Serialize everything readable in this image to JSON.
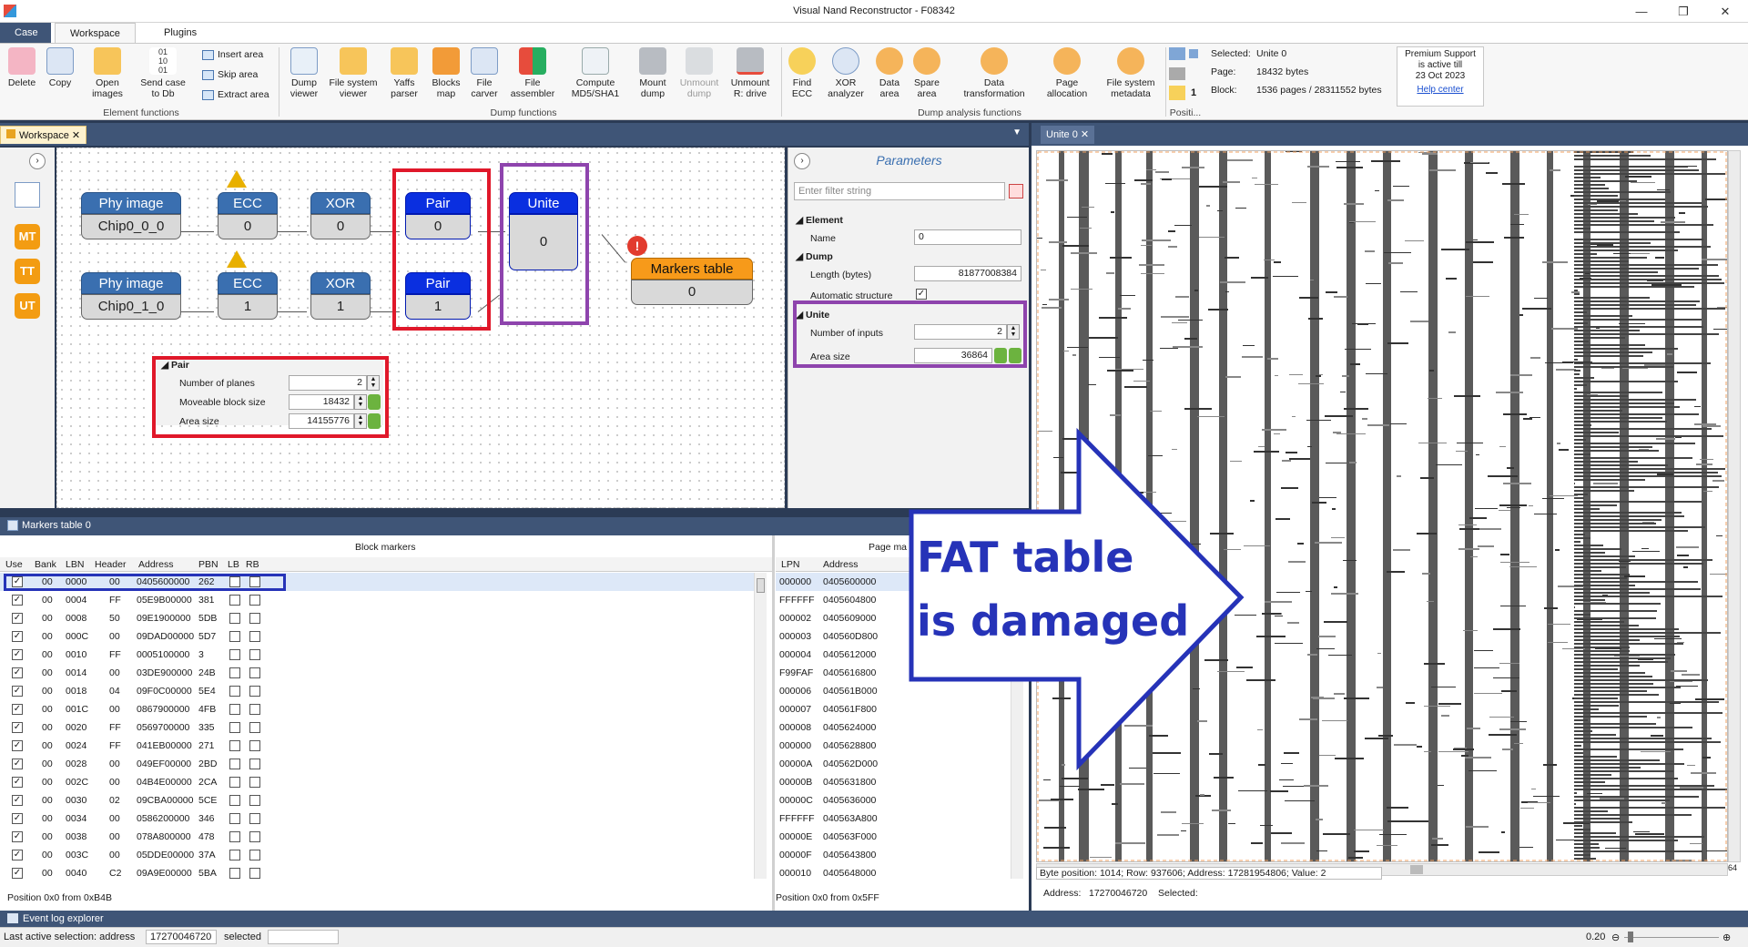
{
  "window": {
    "title": "Visual Nand Reconstructor - F08342"
  },
  "ribbon_tabs": [
    "Case",
    "Workspace",
    "Plugins"
  ],
  "ribbon": {
    "element_functions": {
      "label": "Element functions",
      "buttons": [
        "Delete",
        "Copy",
        "Open images",
        "Send case to Db"
      ],
      "small": [
        "Insert area",
        "Skip area",
        "Extract area"
      ]
    },
    "dump_functions": {
      "label": "Dump functions",
      "buttons": [
        "Dump viewer",
        "File system viewer",
        "Yaffs parser",
        "Blocks map",
        "File carver",
        "File assembler",
        "Compute MD5/SHA1",
        "Mount dump",
        "Unmount dump",
        "Unmount R: drive"
      ]
    },
    "dump_analysis": {
      "label": "Dump analysis functions",
      "buttons": [
        "Find ECC",
        "XOR analyzer",
        "Data area",
        "Spare area",
        "Data transformation",
        "Page allocation",
        "File system metadata"
      ]
    },
    "position": {
      "label": "Positi...",
      "value": "1",
      "selected_label": "Selected:",
      "selected_value": "Unite 0",
      "page_label": "Page:",
      "page_value": "18432 bytes",
      "block_label": "Block:",
      "block_value": "1536 pages / 28311552 bytes"
    },
    "support": {
      "line1": "Premium Support",
      "line2": "is active till",
      "line3": "23 Oct 2023",
      "link": "Help center"
    }
  },
  "workspace_tab": "Workspace",
  "viewer_tab": "Unite 0",
  "nodes": {
    "phy1": {
      "title": "Phy image",
      "value": "Chip0_0_0"
    },
    "phy2": {
      "title": "Phy image",
      "value": "Chip0_1_0"
    },
    "ecc1": {
      "title": "ECC",
      "value": "0"
    },
    "ecc2": {
      "title": "ECC",
      "value": "1"
    },
    "xor1": {
      "title": "XOR",
      "value": "0"
    },
    "xor2": {
      "title": "XOR",
      "value": "1"
    },
    "pair1": {
      "title": "Pair",
      "value": "0"
    },
    "pair2": {
      "title": "Pair",
      "value": "1"
    },
    "unite": {
      "title": "Unite",
      "value": "0"
    },
    "markers": {
      "title": "Markers table",
      "value": "0"
    }
  },
  "pair_props": {
    "section": "Pair",
    "rows": [
      {
        "label": "Number of planes",
        "value": "2"
      },
      {
        "label": "Moveable block size",
        "value": "18432"
      },
      {
        "label": "Area size",
        "value": "14155776"
      }
    ]
  },
  "params": {
    "title": "Parameters",
    "filter_placeholder": "Enter filter string",
    "element_section": "Element",
    "name_label": "Name",
    "name_value": "0",
    "dump_section": "Dump",
    "length_label": "Length (bytes)",
    "length_value": "81877008384",
    "auto_label": "Automatic structure",
    "unite_section": "Unite",
    "inputs_label": "Number of inputs",
    "inputs_value": "2",
    "area_label": "Area size",
    "area_value": "36864"
  },
  "markers_panel": {
    "tab": "Markers table 0",
    "block_markers_title": "Block markers",
    "page_markers_title": "Page ma",
    "columns": [
      "Use",
      "Bank",
      "LBN",
      "Header",
      "Address",
      "PBN",
      "LB",
      "RB"
    ],
    "rows": [
      [
        "00",
        "0000",
        "00",
        "0405600000",
        "262"
      ],
      [
        "00",
        "0004",
        "FF",
        "05E9B00000",
        "381"
      ],
      [
        "00",
        "0008",
        "50",
        "09E1900000",
        "5DB"
      ],
      [
        "00",
        "000C",
        "00",
        "09DAD00000",
        "5D7"
      ],
      [
        "00",
        "0010",
        "FF",
        "0005100000",
        "3"
      ],
      [
        "00",
        "0014",
        "00",
        "03DE900000",
        "24B"
      ],
      [
        "00",
        "0018",
        "04",
        "09F0C00000",
        "5E4"
      ],
      [
        "00",
        "001C",
        "00",
        "0867900000",
        "4FB"
      ],
      [
        "00",
        "0020",
        "FF",
        "0569700000",
        "335"
      ],
      [
        "00",
        "0024",
        "FF",
        "041EB00000",
        "271"
      ],
      [
        "00",
        "0028",
        "00",
        "049EF00000",
        "2BD"
      ],
      [
        "00",
        "002C",
        "00",
        "04B4E00000",
        "2CA"
      ],
      [
        "00",
        "0030",
        "02",
        "09CBA00000",
        "5CE"
      ],
      [
        "00",
        "0034",
        "00",
        "0586200000",
        "346"
      ],
      [
        "00",
        "0038",
        "00",
        "078A800000",
        "478"
      ],
      [
        "00",
        "003C",
        "00",
        "05DDE00000",
        "37A"
      ],
      [
        "00",
        "0040",
        "C2",
        "09A9E00000",
        "5BA"
      ]
    ],
    "page_columns": [
      "LPN",
      "Address"
    ],
    "page_rows": [
      [
        "000000",
        "0405600000"
      ],
      [
        "FFFFFF",
        "0405604800"
      ],
      [
        "000002",
        "0405609000"
      ],
      [
        "000003",
        "040560D800"
      ],
      [
        "000004",
        "0405612000"
      ],
      [
        "F99FAF",
        "0405616800"
      ],
      [
        "000006",
        "040561B000"
      ],
      [
        "000007",
        "040561F800"
      ],
      [
        "000008",
        "0405624000"
      ],
      [
        "000000",
        "0405628800"
      ],
      [
        "00000A",
        "040562D000"
      ],
      [
        "00000B",
        "0405631800"
      ],
      [
        "00000C",
        "0405636000"
      ],
      [
        "FFFFFF",
        "040563A800"
      ],
      [
        "00000E",
        "040563F000"
      ],
      [
        "00000F",
        "0405643800"
      ],
      [
        "000010",
        "0405648000"
      ]
    ],
    "block_position": "Position 0x0 from 0xB4B",
    "page_position": "Position 0x0 from 0x5FF"
  },
  "viewer": {
    "byte_status": "Byte position: 1014; Row: 937606; Address: 17281954806; Value: 2",
    "address_label": "Address:",
    "address_value": "17270046720",
    "selected_label": "Selected:",
    "corner": "64"
  },
  "annotation": {
    "line1": "FAT table",
    "line2": "is damaged"
  },
  "event_log": "Event log explorer",
  "status": {
    "label": "Last active selection:  address",
    "address": "17270046720",
    "selected": "selected",
    "zoom": "0.20"
  },
  "colors": {
    "accent": "#3f5577",
    "red": "#e0182a",
    "purple": "#8e44ad",
    "blue": "#2633b8",
    "node_blue": "#3a6fb0",
    "node_selected": "#0a2fe0",
    "orange": "#f79a1a"
  }
}
